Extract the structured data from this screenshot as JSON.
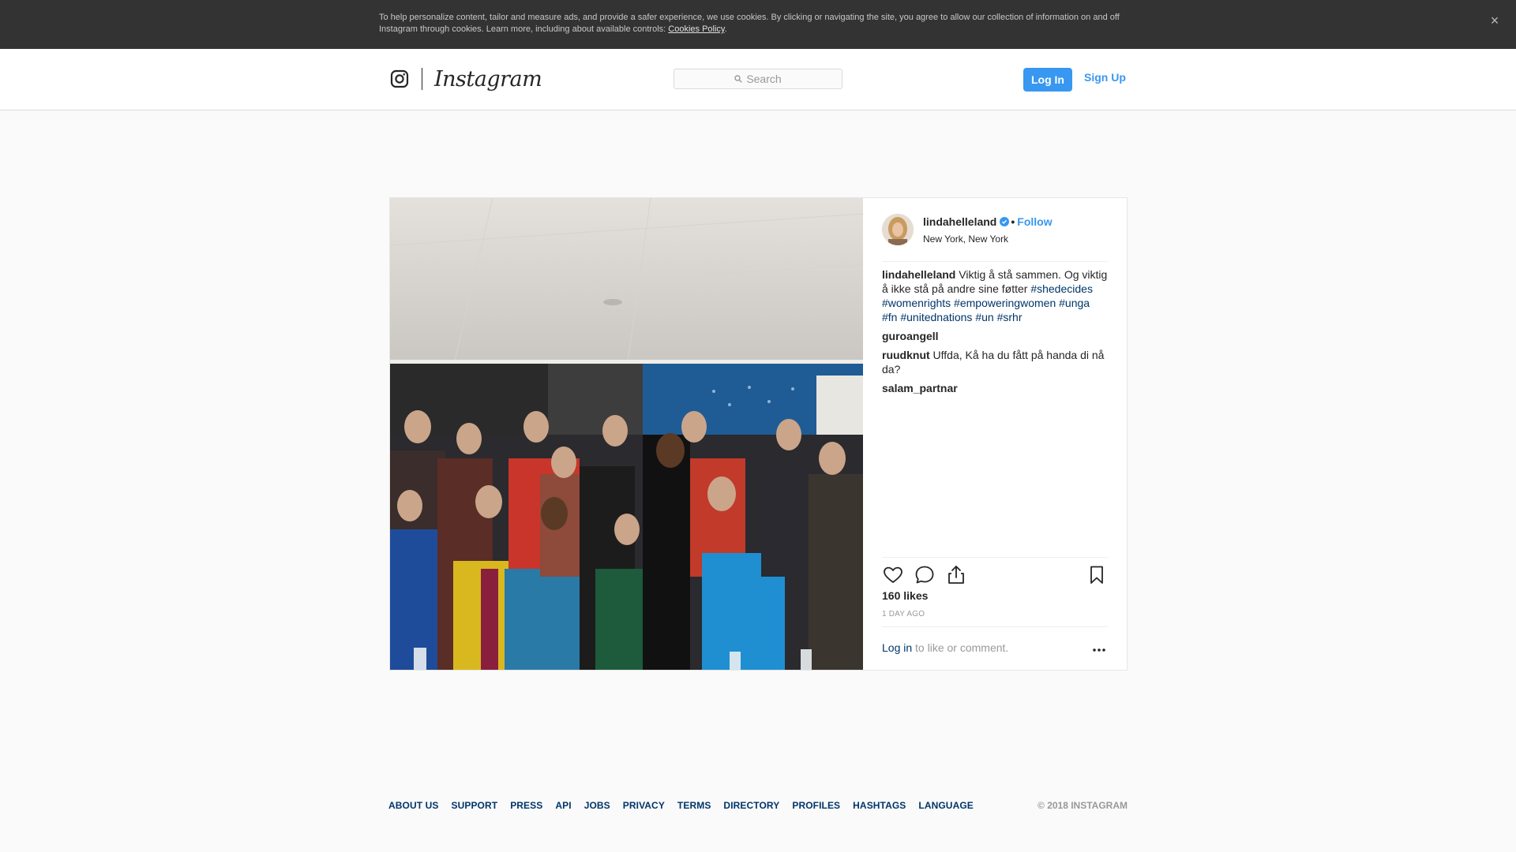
{
  "cookie_banner": {
    "text": "To help personalize content, tailor and measure ads, and provide a safer experience, we use cookies. By clicking or navigating the site, you agree to allow our collection of information on and off Instagram through cookies. Learn more, including about available controls: ",
    "policy_link": "Cookies Policy",
    "policy_suffix": ".",
    "close_icon": "×"
  },
  "header": {
    "logo_text": "Instagram",
    "search_placeholder": "Search",
    "login_label": "Log In",
    "signup_label": "Sign Up"
  },
  "post": {
    "username": "lindahelleland",
    "separator": "•",
    "follow_label": "Follow",
    "location": "New York, New York",
    "caption": {
      "user": "lindahelleland",
      "text": "Viktig å stå sammen. Og viktig å ikke stå på andre sine føtter ",
      "emoji": "",
      "hashtags": [
        "#shedecides",
        "#womenrights",
        "#empoweringwomen",
        "#unga",
        "#fn",
        "#unitednations",
        "#un",
        "#srhr"
      ]
    },
    "comments": [
      {
        "user": "guroangell",
        "text": " "
      },
      {
        "user": "ruudknut",
        "text": "Uffda, Kå ha du fått på handa di nå da?"
      },
      {
        "user": "salam_partnar",
        "text": ""
      }
    ],
    "likes": "160 likes",
    "time": "1 DAY AGO",
    "login_link": "Log in",
    "login_suffix": " to like or comment.",
    "more_icon": "..."
  },
  "footer": {
    "links": [
      "ABOUT US",
      "SUPPORT",
      "PRESS",
      "API",
      "JOBS",
      "PRIVACY",
      "TERMS",
      "DIRECTORY",
      "PROFILES",
      "HASHTAGS",
      "LANGUAGE"
    ],
    "copyright": "© 2018 INSTAGRAM"
  },
  "colors": {
    "accent": "#3897f0",
    "link_dark": "#003569",
    "banner_bg": "#333333",
    "muted": "#999999"
  },
  "icons": [
    "instagram-glyph-icon",
    "search-icon",
    "close-icon",
    "verified-badge-icon",
    "heart-icon",
    "comment-icon",
    "share-icon",
    "bookmark-icon",
    "more-icon"
  ]
}
